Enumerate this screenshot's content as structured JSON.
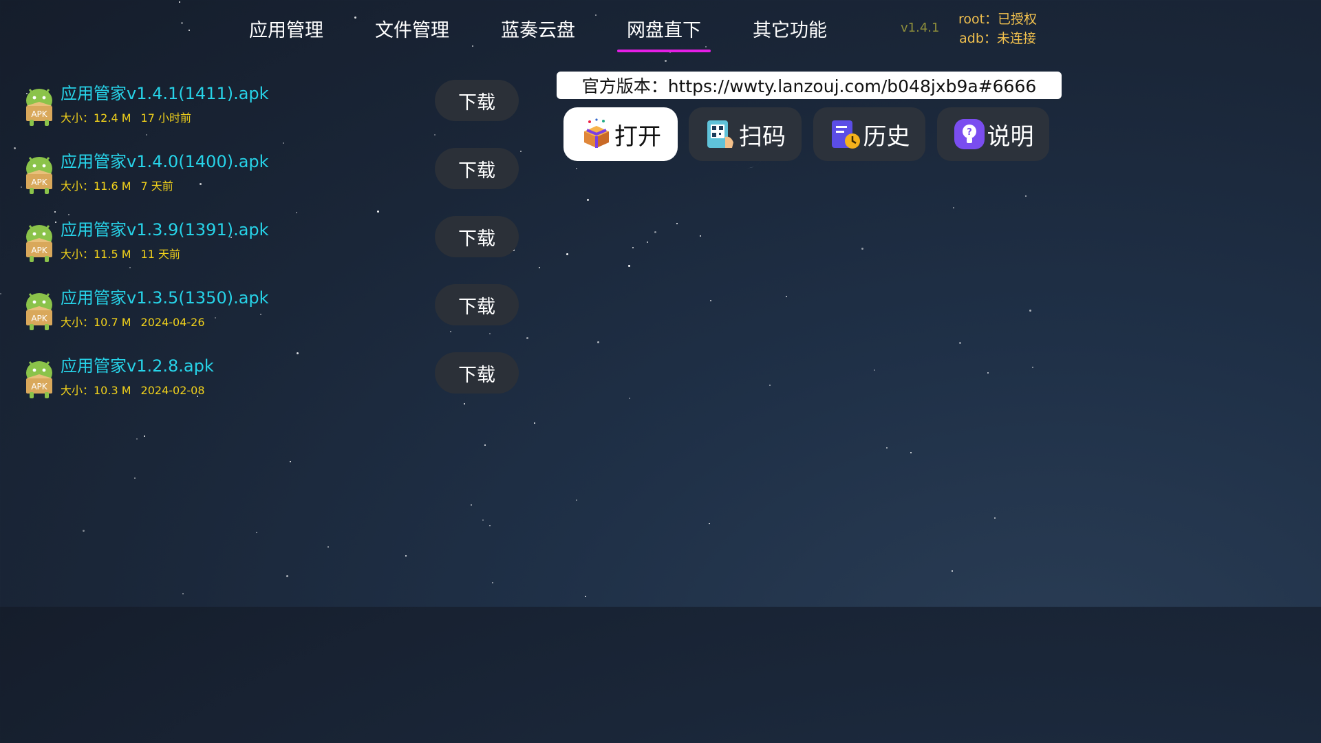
{
  "nav": {
    "tabs": [
      {
        "label": "应用管理",
        "active": false
      },
      {
        "label": "文件管理",
        "active": false
      },
      {
        "label": "蓝奏云盘",
        "active": false
      },
      {
        "label": "网盘直下",
        "active": true
      },
      {
        "label": "其它功能",
        "active": false
      }
    ],
    "version": "v1.4.1",
    "root_status": "root：已授权",
    "adb_status": "adb：未连接",
    "accent_color": "#e51ee5"
  },
  "files": [
    {
      "name": "应用管家v1.4.1(1411).apk",
      "size": "大小：12.4 M",
      "date": "17 小时前",
      "action": "下载",
      "icon": "android-apk-icon"
    },
    {
      "name": "应用管家v1.4.0(1400).apk",
      "size": "大小：11.6 M",
      "date": "7 天前",
      "action": "下载",
      "icon": "android-apk-icon"
    },
    {
      "name": "应用管家v1.3.9(1391).apk",
      "size": "大小：11.5 M",
      "date": "11 天前",
      "action": "下载",
      "icon": "android-apk-icon"
    },
    {
      "name": "应用管家v1.3.5(1350).apk",
      "size": "大小：10.7 M",
      "date": "2024-04-26",
      "action": "下载",
      "icon": "android-apk-icon"
    },
    {
      "name": "应用管家v1.2.8.apk",
      "size": "大小：10.3 M",
      "date": "2024-02-08",
      "action": "下载",
      "icon": "android-apk-icon"
    }
  ],
  "panel": {
    "official_url": "官方版本：https://wwty.lanzouj.com/b048jxb9a#6666",
    "actions": [
      {
        "label": "打开",
        "icon": "gift-box-icon"
      },
      {
        "label": "扫码",
        "icon": "qr-scan-icon"
      },
      {
        "label": "历史",
        "icon": "history-icon"
      },
      {
        "label": "说明",
        "icon": "help-icon"
      }
    ]
  },
  "colors": {
    "filename": "#27d3e8",
    "meta": "#f2d21b",
    "status": "#f2c14e",
    "button_bg": "#2b3038"
  }
}
